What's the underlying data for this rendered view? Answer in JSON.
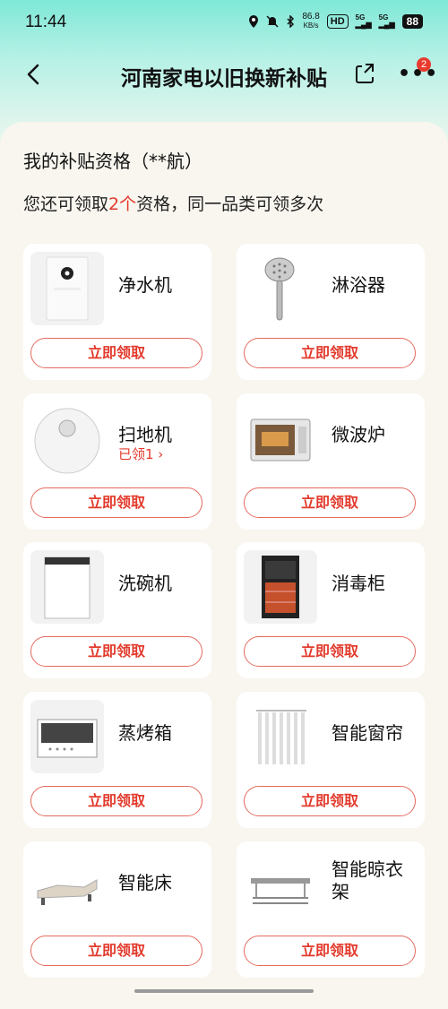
{
  "status_bar": {
    "time": "11:44",
    "speed_value": "86.8",
    "speed_unit": "KB/s",
    "hd_label": "HD",
    "sig1": "5G",
    "sig2": "5G",
    "battery": "88"
  },
  "header": {
    "title": "河南家电以旧换新补贴",
    "notification_count": "2"
  },
  "eligibility": {
    "title": "我的补贴资格（**航）",
    "remain_prefix": "您还可领取",
    "remain_count": "2个",
    "remain_suffix": "资格，同一品类可领多次"
  },
  "items": [
    {
      "name": "净水机",
      "button": "立即领取",
      "icon": "water-purifier-icon"
    },
    {
      "name": "淋浴器",
      "button": "立即领取",
      "icon": "shower-head-icon"
    },
    {
      "name": "扫地机",
      "sub": "已领1 ›",
      "button": "立即领取",
      "icon": "robot-vacuum-icon"
    },
    {
      "name": "微波炉",
      "button": "立即领取",
      "icon": "microwave-icon"
    },
    {
      "name": "洗碗机",
      "button": "立即领取",
      "icon": "dishwasher-icon"
    },
    {
      "name": "消毒柜",
      "button": "立即领取",
      "icon": "disinfection-cabinet-icon"
    },
    {
      "name": "蒸烤箱",
      "button": "立即领取",
      "icon": "steam-oven-icon"
    },
    {
      "name": "智能窗帘",
      "button": "立即领取",
      "icon": "smart-curtain-icon"
    },
    {
      "name": "智能床",
      "button": "立即领取",
      "icon": "smart-bed-icon"
    },
    {
      "name": "智能晾衣架",
      "button": "立即领取",
      "icon": "clothes-rack-icon"
    }
  ]
}
